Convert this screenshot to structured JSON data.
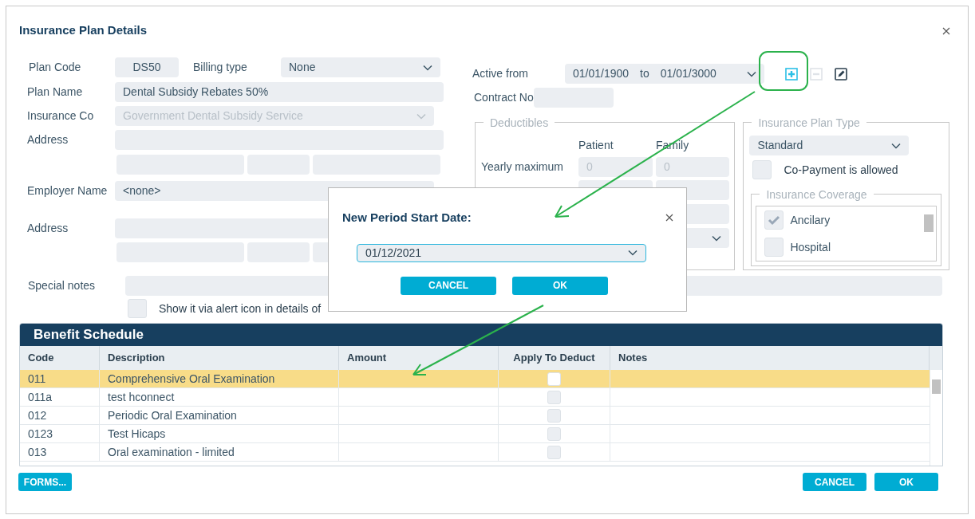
{
  "dialog": {
    "title": "Insurance Plan Details"
  },
  "form": {
    "plan_code": {
      "label": "Plan Code",
      "value": "DS50"
    },
    "billing_type": {
      "label": "Billing type",
      "value": "None"
    },
    "plan_name": {
      "label": "Plan Name",
      "value": "Dental Subsidy Rebates 50%"
    },
    "insurance_co": {
      "label": "Insurance Co",
      "value": "Government Dental Subsidy Service",
      "disabled": true
    },
    "address": {
      "label": "Address"
    },
    "employer_name": {
      "label": "Employer Name",
      "value": "<none>"
    },
    "employer_address": {
      "label": "Address"
    },
    "special_notes": {
      "label": "Special notes"
    },
    "alert_option": {
      "label": "Show it via alert icon in details of",
      "checked": false
    }
  },
  "active_period": {
    "label": "Active from",
    "from": "01/01/1900",
    "separator": "to",
    "to": "01/01/3000"
  },
  "period_tools": [
    {
      "kind": "add",
      "disabled": false
    },
    {
      "kind": "remove",
      "disabled": true
    },
    {
      "kind": "edit",
      "disabled": false
    }
  ],
  "contract_no": {
    "label": "Contract No"
  },
  "deductibles": {
    "title": "Deductibles",
    "columns": [
      "Patient",
      "Family"
    ],
    "rows": [
      {
        "label": "Yearly maximum",
        "patient": "0",
        "family": "0"
      }
    ]
  },
  "plan_type": {
    "title": "Insurance Plan Type",
    "value": "Standard",
    "copayment": {
      "label": "Co-Payment is allowed",
      "checked": false
    },
    "coverage": {
      "title": "Insurance Coverage",
      "items": [
        {
          "label": "Ancilary",
          "checked": true
        },
        {
          "label": "Hospital",
          "checked": false
        }
      ]
    }
  },
  "benefit_schedule": {
    "title": "Benefit Schedule",
    "columns": [
      "Code",
      "Description",
      "Amount",
      "Apply To Deduct",
      "Notes"
    ],
    "rows": [
      {
        "code": "011",
        "description": "Comprehensive Oral Examination",
        "apply_to_deduct": false,
        "selected": true
      },
      {
        "code": "011a",
        "description": "test hconnect",
        "apply_to_deduct": false,
        "selected": false
      },
      {
        "code": "012",
        "description": "Periodic Oral Examination",
        "apply_to_deduct": false,
        "selected": false
      },
      {
        "code": "0123",
        "description": "Test Hicaps",
        "apply_to_deduct": false,
        "selected": false
      },
      {
        "code": "013",
        "description": "Oral examination - limited",
        "apply_to_deduct": false,
        "selected": false
      }
    ]
  },
  "buttons": {
    "forms": "FORMS...",
    "cancel": "CANCEL",
    "ok": "OK"
  },
  "modal": {
    "title": "New Period Start Date:",
    "value": "01/12/2021",
    "buttons": [
      "CANCEL",
      "OK"
    ]
  }
}
